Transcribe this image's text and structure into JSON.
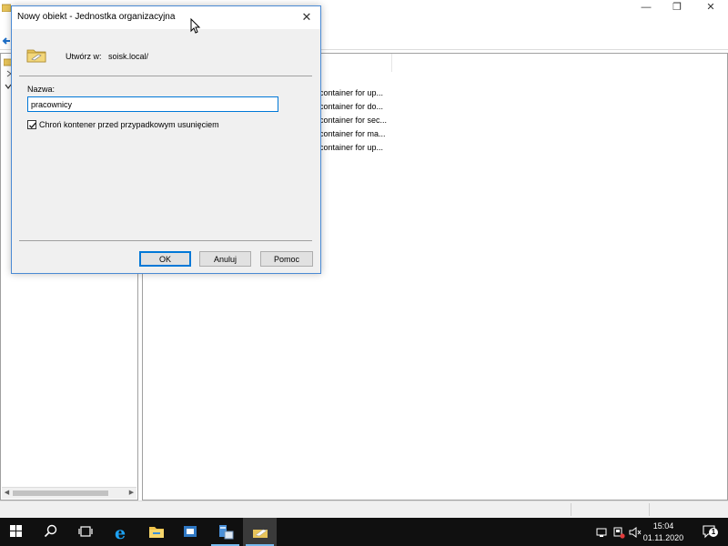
{
  "background_window": {
    "list_rows": [
      "container for up...",
      "container for do...",
      "container for sec...",
      "container for ma...",
      "container for up..."
    ]
  },
  "dialog": {
    "title": "Nowy obiekt - Jednostka organizacyjna",
    "create_in_label": "Utwórz w:",
    "create_in_value": "soisk.local/",
    "name_label": "Nazwa:",
    "name_value": "pracownicy",
    "protect_checkbox_label": "Chroń kontener przed przypadkowym usunięciem",
    "protect_checked": true,
    "buttons": {
      "ok": "OK",
      "cancel": "Anuluj",
      "help": "Pomoc"
    }
  },
  "taskbar": {
    "time": "15:04",
    "date": "01.11.2020",
    "notification_count": "1",
    "icons": [
      "start-icon",
      "search-icon",
      "task-view-icon",
      "internet-explorer-icon",
      "file-explorer-icon",
      "server-manager-icon",
      "ad-users-computers-icon",
      "ou-wizard-icon"
    ]
  },
  "colors": {
    "accent": "#0078d7",
    "taskbar": "#101010",
    "dialog_bg": "#f0f0f0"
  }
}
